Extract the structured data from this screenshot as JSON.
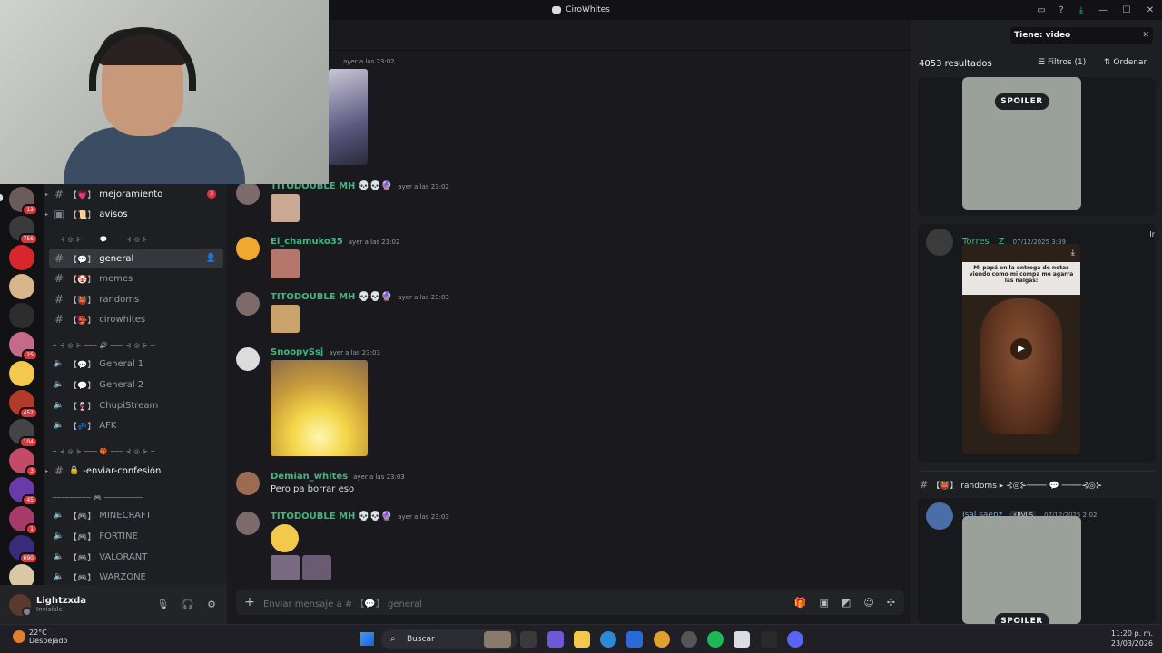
{
  "window": {
    "title": "CiroWhites"
  },
  "servers": [
    {
      "badge": "13"
    },
    {
      "badge": "756"
    },
    {
      "badge": ""
    },
    {
      "badge": ""
    },
    {
      "badge": ""
    },
    {
      "badge": "25"
    },
    {
      "badge": ""
    },
    {
      "badge": "452"
    },
    {
      "badge": "104"
    },
    {
      "badge": "3"
    },
    {
      "badge": "45"
    },
    {
      "badge": "1"
    },
    {
      "badge": "690"
    },
    {
      "badge": ""
    }
  ],
  "channels": {
    "text1": [
      {
        "label": "mejoramiento",
        "badge": "3"
      },
      {
        "label": "avisos",
        "badge": ""
      }
    ],
    "cat1": "─ ⊰ ◎ ⊱ ─── 💬 ─── ⊰ ◎ ⊱ ─",
    "text2": [
      {
        "label": "general"
      },
      {
        "label": "memes"
      },
      {
        "label": "randoms"
      },
      {
        "label": "cirowhites"
      }
    ],
    "cat2": "─ ⊰ ◎ ⊱ ─── 🔊 ─── ⊰ ◎ ⊱ ─",
    "voice1": [
      {
        "label": "General 1"
      },
      {
        "label": "General 2"
      },
      {
        "label": "ChupiStream"
      },
      {
        "label": "AFK"
      }
    ],
    "cat3": "─ ⊰ ◎ ⊱ ─── 🎁 ─── ⊰ ◎ ⊱ ─",
    "confession": "-enviar-confesión",
    "cat4": "───────── 🎮 ─────────",
    "voice2": [
      {
        "label": "MINECRAFT"
      },
      {
        "label": "FORTINE"
      },
      {
        "label": "VALORANT"
      },
      {
        "label": "WARZONE"
      }
    ]
  },
  "user": {
    "name": "Lightzxda",
    "status": "Invisible"
  },
  "chat": {
    "messages": [
      {
        "author": "TITODOUBLE MH 💀💀🔮",
        "time": "ayer a las 23:02",
        "text": ""
      },
      {
        "author": "El_chamuko35",
        "time": "ayer a las 23:02",
        "text": ""
      },
      {
        "author": "TITODOUBLE MH 💀💀🔮",
        "time": "ayer a las 23:03",
        "text": ""
      },
      {
        "author": "SnoopySsj",
        "time": "ayer a las 23:03",
        "text": ""
      },
      {
        "author": "Demian_whites",
        "time": "ayer a las 23:03",
        "text": "Pero pa borrar eso"
      },
      {
        "author": "TITODOUBLE MH 💀💀🔮",
        "time": "ayer a las 23:03",
        "text": ""
      }
    ],
    "first_time": "ayer a las 23:02",
    "composer_placeholder": "Enviar mensaje a # 【💬】 general"
  },
  "search_panel": {
    "query": "Tiene: video",
    "results_count": "4053 resultados",
    "filters_label": "Filtros (1)",
    "sort_label": "Ordenar",
    "spoiler_label": "SPOILER",
    "result1": {
      "author": "Torres__Z",
      "time": "07/12/2025 3:39",
      "jump": "Ir",
      "caption": "Mi papá en la entrega de notas viendo como mi compa me agarra las nalgas:"
    },
    "channel_header": "【👹】 randoms ▸ ⊰◎⊱──── 💬 ────⊰◎⊱",
    "result2": {
      "author": "Isai saenz",
      "tag": "⚡RVLS",
      "time": "07/12/2025 2:02"
    }
  },
  "taskbar": {
    "temperature": "22°C",
    "weather": "Despejado",
    "search_label": "Buscar",
    "time": "11:20 p. m.",
    "date": "23/03/2026"
  },
  "colors": {
    "accent": "#5865f2",
    "green_name": "#43b581",
    "danger": "#da373c"
  }
}
